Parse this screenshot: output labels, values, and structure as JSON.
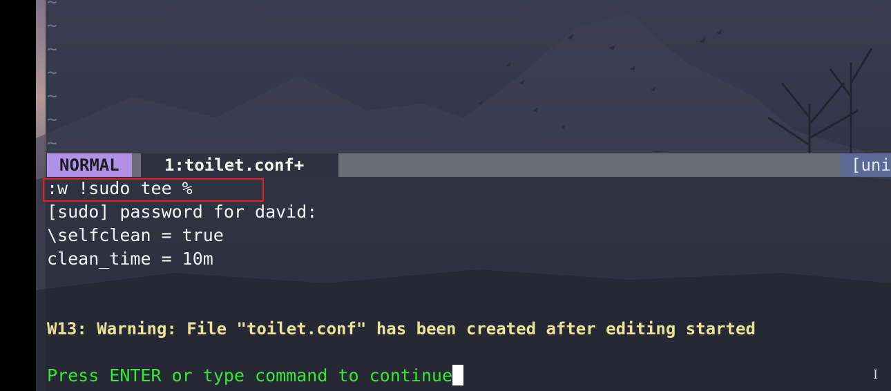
{
  "editor": {
    "empty_line_marker": "~",
    "mode": "NORMAL",
    "buffer_tab": "1:toilet.conf+",
    "encoding_fragment": "[uni"
  },
  "cmdline": {
    "command": ":w !sudo tee %",
    "output_lines": [
      "[sudo] password for david:",
      "\\selfclean = true",
      "clean_time = 10m"
    ],
    "warning": "W13: Warning: File \"toilet.conf\" has been created after editing started",
    "prompt": "Press ENTER or type command to continue"
  },
  "colors": {
    "mode_badge": "#b191e6",
    "warning_text": "#e8e59a",
    "prompt_text": "#34e834",
    "annotation_box": "#e0201e"
  }
}
